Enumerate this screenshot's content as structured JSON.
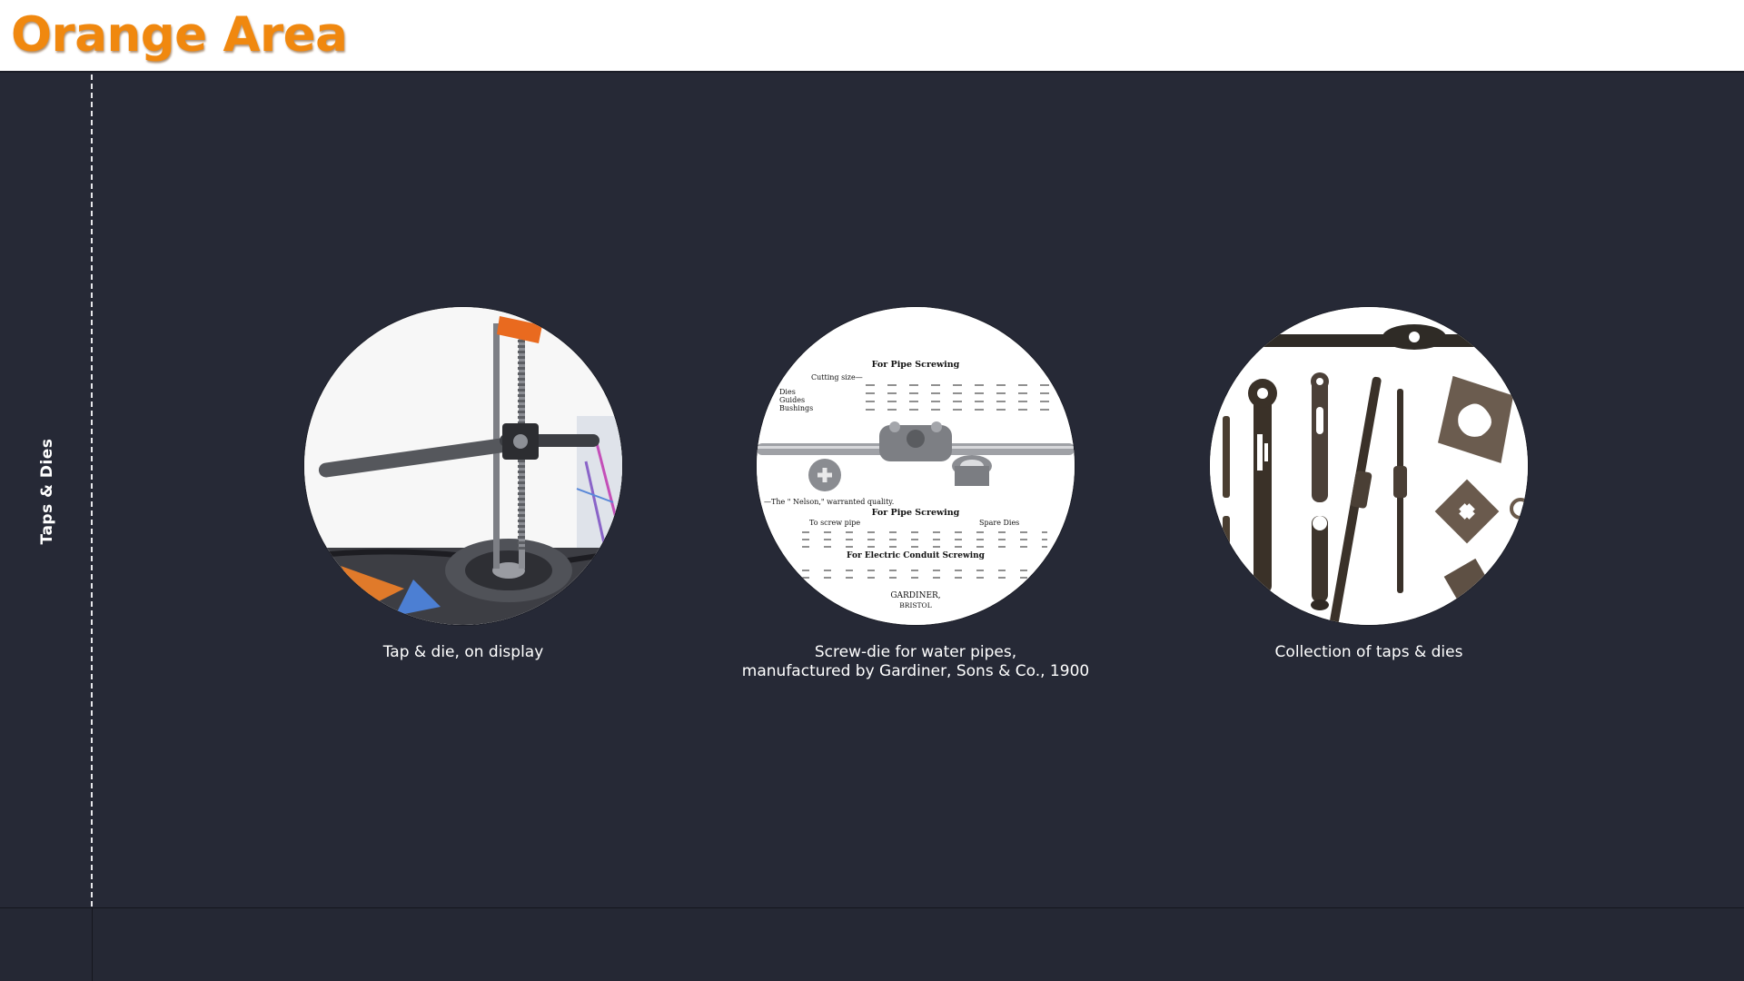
{
  "header": {
    "title": "Orange Area"
  },
  "sidebar": {
    "section_label": "Taps & Dies"
  },
  "gallery": {
    "items": [
      {
        "image": "tap-and-die-photo",
        "caption_lines": [
          "Tap & die, on display"
        ]
      },
      {
        "image": "catalogue-page-photo",
        "caption_lines": [
          "Screw-die for water pipes,",
          "manufactured by Gardiner, Sons & Co., 1900"
        ],
        "image_text": {
          "top_line": "Cutting size—",
          "heading_1": "For Pipe Screwing",
          "row_dies": "Dies",
          "row_guides": "Guides",
          "row_bushings": "Bushings",
          "quality_note": "—The \" Nelson,\" warranted quality.",
          "heading_2": "For Pipe Screwing",
          "col_to_screw": "To screw pipe",
          "col_spare": "Spare Dies",
          "heading_3": "For Electric Conduit Screwing",
          "maker": "GARDINER,",
          "city": "BRISTOL"
        }
      },
      {
        "image": "taps-collection-photo",
        "caption_lines": [
          "Collection of taps & dies"
        ]
      }
    ]
  },
  "colors": {
    "accent": "#f0880f",
    "background": "#262936",
    "header_bg": "#ffffff",
    "text": "#ffffff"
  }
}
